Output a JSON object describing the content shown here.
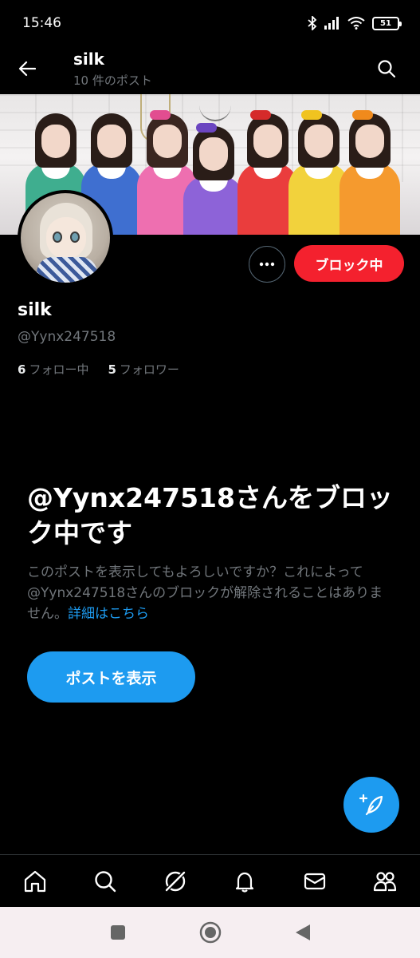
{
  "status_bar": {
    "time": "15:46",
    "battery": "51",
    "icons": [
      "bluetooth-icon",
      "signal-icon",
      "wifi-icon",
      "battery-icon"
    ]
  },
  "header": {
    "title": "silk",
    "post_count": "10 件のポスト",
    "back_icon": "back-arrow-icon",
    "search_icon": "search-icon"
  },
  "profile": {
    "name": "silk",
    "handle": "@Yynx247518",
    "following_count": "6",
    "following_label": "フォロー中",
    "followers_count": "5",
    "followers_label": "フォロワー"
  },
  "actions": {
    "more_icon": "more-icon",
    "block_label": "ブロック中"
  },
  "blocked": {
    "title": "@Yynx247518さんをブロック中です",
    "description": "このポストを表示してもよろしいですか？これによって@Yynx247518さんのブロックが解除されることはありません。",
    "learn_more": "詳細はこちら",
    "show_posts_label": "ポストを表示"
  },
  "fab": {
    "icon": "compose-icon"
  },
  "bottom_nav": [
    "home-icon",
    "search-icon",
    "grok-icon",
    "notifications-icon",
    "messages-icon",
    "communities-icon"
  ],
  "system_nav": [
    "recents-icon",
    "home-circle-icon",
    "back-triangle-icon"
  ],
  "colors": {
    "background": "#000000",
    "block_red": "#f4212e",
    "accent_blue": "#1d9bf0",
    "secondary_text": "#71767b"
  }
}
